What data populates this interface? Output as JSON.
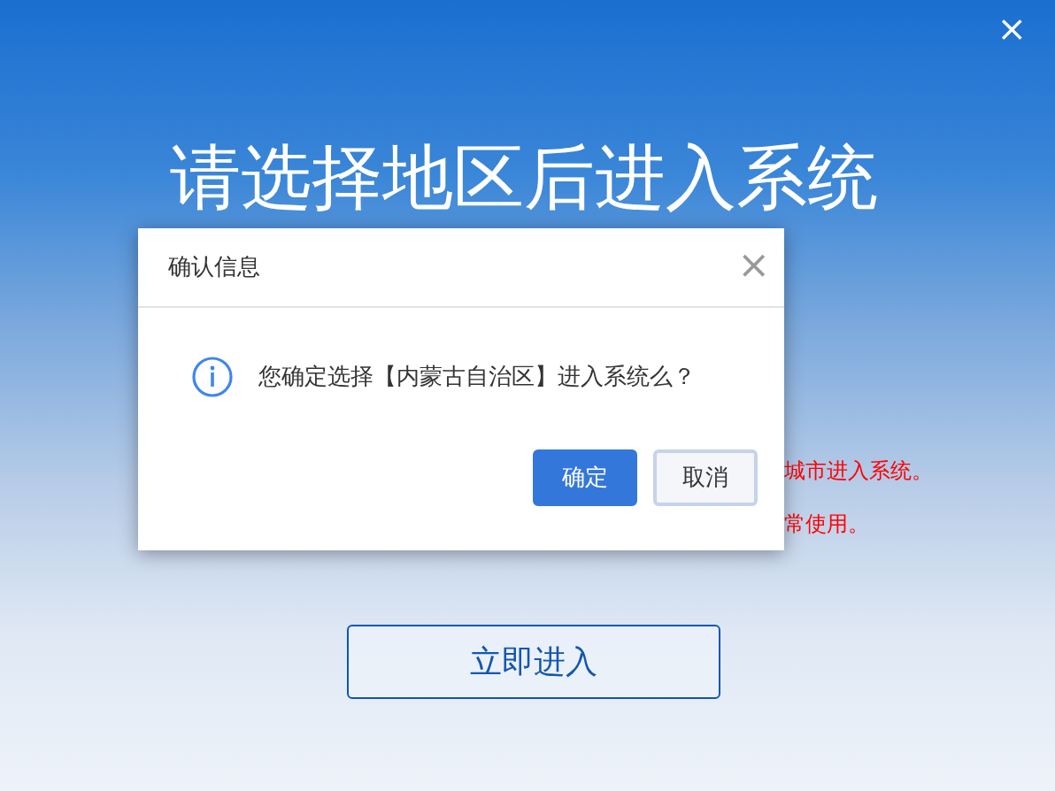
{
  "window": {
    "close": "×"
  },
  "heading": "请选择地区后进入系统",
  "notes": [
    "城市进入系统。",
    "常使用。"
  ],
  "enter_button": "立即进入",
  "dialog": {
    "title": "确认信息",
    "close": "×",
    "message": "您确定选择【内蒙古自治区】进入系统么？",
    "buttons": [
      {
        "label": "确定",
        "kind": "primary"
      },
      {
        "label": "取消",
        "kind": "secondary"
      }
    ]
  }
}
